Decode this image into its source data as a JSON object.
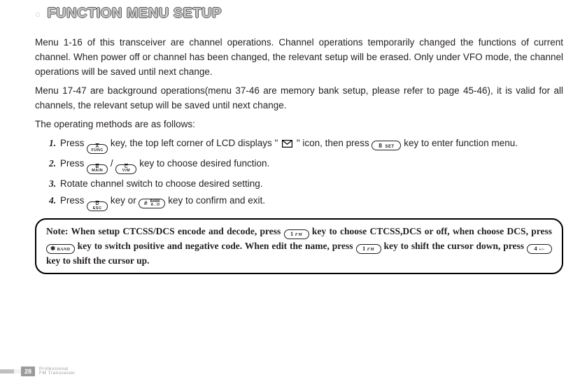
{
  "title": "FUNCTION MENU SETUP",
  "para1": "Menu 1-16 of this transceiver are channel operations. Channel operations temporarily changed the functions of current channel. When power off or channel has been changed, the relevant setup will be erased. Only under VFO mode, the channel operations will be saved until next change.",
  "para2": "Menu 17-47 are background operations(menu 37-46 are memory bank setup, please refer to page 45-46), it is valid for all channels, the relevant setup will be saved until next change.",
  "para3": "The operating methods are as follows:",
  "steps": {
    "n1": "1.",
    "n2": "2.",
    "n3": "3.",
    "n4": "4.",
    "s1a": "Press ",
    "s1b": " key, the top left corner of LCD displays \" ",
    "s1c": " \" icon, then press ",
    "s1d": " key to enter function menu.",
    "s2a": "Press ",
    "s2b": " / ",
    "s2c": " key to choose desired function.",
    "s3": "Rotate channel switch to choose desired setting.",
    "s4a": "Press ",
    "s4b": " key or ",
    "s4c": " key to confirm and exit."
  },
  "note": {
    "n1": "Note: When setup CTCSS/DCS encode and decode, press ",
    "n2": " key to choose CTCSS,DCS or off, when choose DCS, press ",
    "n3": " key to switch positive and negative code. When edit the name, press ",
    "n4": " key to shift the cursor down, press ",
    "n5": " key to shift the cursor up."
  },
  "keys": {
    "a_func_top": "A",
    "a_func_bot": "FUNC",
    "b_main_top": "B",
    "b_main_bot": "MAIN",
    "c_vm_top": "C",
    "c_vm_bot": "V/M",
    "d_esc_top": "D",
    "d_esc_bot": "ESC",
    "eight": "8",
    "eight_set": "SET",
    "hash": "#",
    "hash_bank": "BANK",
    "hash_ao": "A↔O",
    "one": "1",
    "one_fm": "FM",
    "star": "✱",
    "star_band": "BAND",
    "four": "4",
    "four_pm": "+/-"
  },
  "icons": {
    "envelope": "envelope-icon"
  },
  "footer": {
    "page_number": "28",
    "line1": "Professional",
    "line2": "FM Transceiver"
  }
}
